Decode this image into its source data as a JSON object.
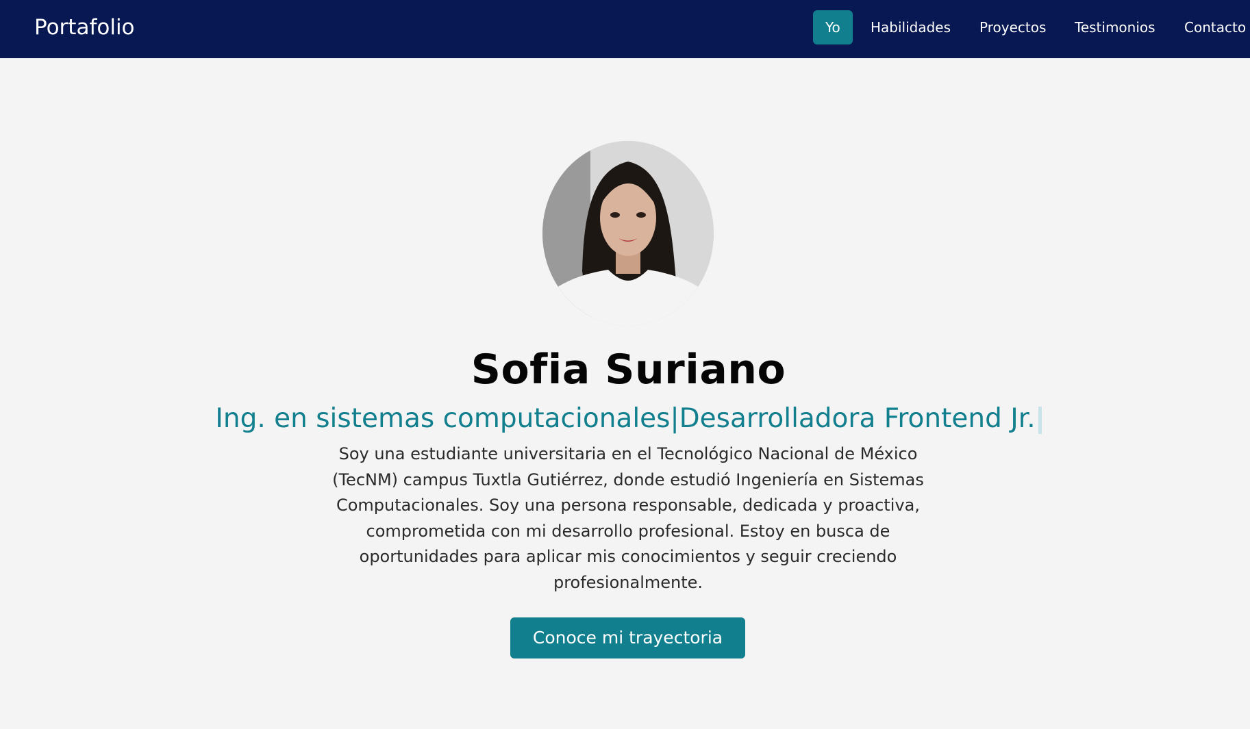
{
  "nav": {
    "brand": "Portafolio",
    "items": [
      {
        "label": "Yo",
        "active": true
      },
      {
        "label": "Habilidades",
        "active": false
      },
      {
        "label": "Proyectos",
        "active": false
      },
      {
        "label": "Testimonios",
        "active": false
      },
      {
        "label": "Contacto",
        "active": false
      }
    ]
  },
  "hero": {
    "name": "Sofia Suriano",
    "role": "Ing. en sistemas computacionales|Desarrolladora Frontend Jr.",
    "bio": "Soy una estudiante universitaria en el Tecnológico Nacional de México (TecNM) campus Tuxtla Gutiérrez, donde estudió Ingeniería en Sistemas Computacionales. Soy una persona responsable, dedicada y proactiva, comprometida con mi desarrollo profesional. Estoy en busca de oportunidades para aplicar mis conocimientos y seguir creciendo profesionalmente.",
    "cta_label": "Conoce mi trayectoria"
  },
  "colors": {
    "navbar_bg": "#081853",
    "accent": "#117f8e",
    "page_bg": "#f4f4f4"
  }
}
